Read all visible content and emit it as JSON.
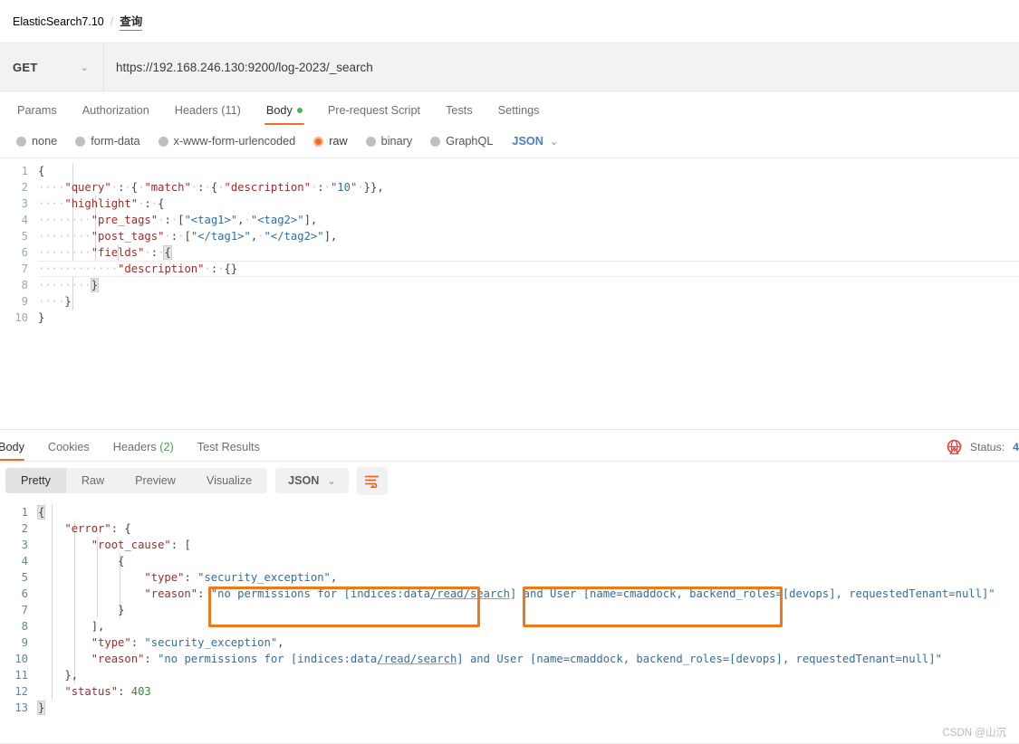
{
  "breadcrumb": {
    "root": "ElasticSearch7.10",
    "separator": "/",
    "current": "查询"
  },
  "request": {
    "method": "GET",
    "method_chevron": "⌄",
    "url": "https://192.168.246.130:9200/log-2023/_search",
    "tabs": [
      {
        "label": "Params",
        "active": false
      },
      {
        "label": "Authorization",
        "active": false
      },
      {
        "label": "Headers (11)",
        "active": false
      },
      {
        "label": "Body",
        "active": true,
        "dot": true
      },
      {
        "label": "Pre-request Script",
        "active": false
      },
      {
        "label": "Tests",
        "active": false
      },
      {
        "label": "Settings",
        "active": false
      }
    ],
    "body_types": [
      {
        "label": "none",
        "selected": false
      },
      {
        "label": "form-data",
        "selected": false
      },
      {
        "label": "x-www-form-urlencoded",
        "selected": false
      },
      {
        "label": "raw",
        "selected": true
      },
      {
        "label": "binary",
        "selected": false
      },
      {
        "label": "GraphQL",
        "selected": false
      }
    ],
    "format": "JSON",
    "format_chevron": "⌄",
    "body_lines": [
      "{",
      "    \"query\" : { \"match\" : { \"description\" : \"10\" }},",
      "    \"highlight\" : {",
      "        \"pre_tags\" : [\"<tag1>\", \"<tag2>\"],",
      "        \"post_tags\" : [\"</tag1>\", \"</tag2>\"],",
      "        \"fields\" : {",
      "            \"description\" : {}",
      "        }",
      "    }",
      "}"
    ],
    "active_line": 7
  },
  "response": {
    "tabs": [
      {
        "label": "Body",
        "active": true
      },
      {
        "label": "Cookies",
        "active": false
      },
      {
        "label": "Headers",
        "count": "(2)",
        "active": false
      },
      {
        "label": "Test Results",
        "active": false
      }
    ],
    "status_label": "Status:",
    "status_value": "4",
    "status_icon": "error-globe-icon",
    "view_modes": [
      {
        "label": "Pretty",
        "active": true
      },
      {
        "label": "Raw",
        "active": false
      },
      {
        "label": "Preview",
        "active": false
      },
      {
        "label": "Visualize",
        "active": false
      }
    ],
    "format": "JSON",
    "format_chevron": "⌄",
    "wrap_icon": "wrap-text-icon",
    "body_lines": [
      "{",
      "    \"error\": {",
      "        \"root_cause\": [",
      "            {",
      "                \"type\": \"security_exception\",",
      "                \"reason\": \"no permissions for [indices:data/read/search] and User [name=cmaddock, backend_roles=[devops], requestedTenant=null]\"",
      "            }",
      "        ],",
      "        \"type\": \"security_exception\",",
      "        \"reason\": \"no permissions for [indices:data/read/search] and User [name=cmaddock, backend_roles=[devops], requestedTenant=null]\"",
      "    },",
      "    \"status\": 403",
      "}"
    ],
    "annotations": [
      {
        "name": "permission-action-highlight",
        "label": "no permissions for [indices:data/read/search]"
      },
      {
        "name": "user-identity-highlight",
        "label": "[name=cmaddock, backend_roles=[devops], requestedTenant=null]"
      }
    ]
  },
  "watermark": "CSDN @山沉",
  "colors": {
    "accent": "#ef6c2e",
    "annotation": "#f07818",
    "status_blue": "#2f80c9",
    "green_dot": "#3fb950"
  }
}
